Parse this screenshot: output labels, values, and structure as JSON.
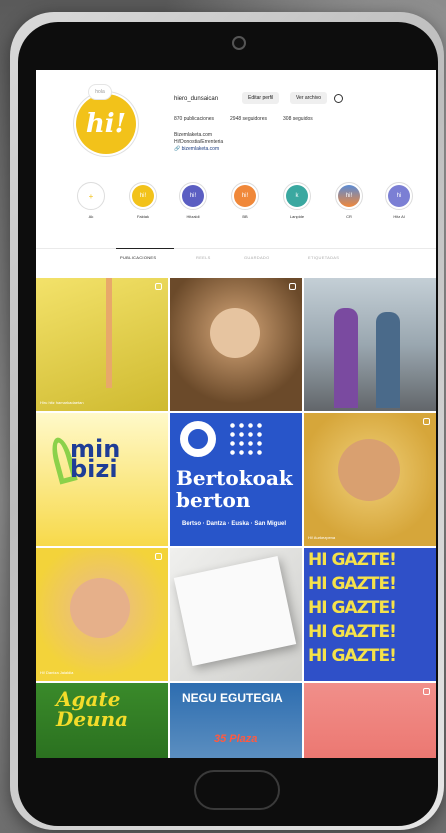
{
  "profile": {
    "avatar_text": "hi!",
    "avatar_bubble": "hola",
    "username": "hiero_dunsaican",
    "edit_label": "Editar perfil",
    "archive_label": "Ver archivo",
    "stats": {
      "posts": "870 publicaciones",
      "followers": "2948 seguidores",
      "following": "308 seguidos"
    },
    "bio_line1": "Bizemlaketa.com",
    "bio_line2": "Hi!Donostia/Errenteria",
    "bio_link": "🔗 bizemlaketa.com"
  },
  "highlights": [
    {
      "label": "Ak",
      "color": "#ffffff"
    },
    {
      "label": "Faktak",
      "color": "#f2c21a"
    },
    {
      "label": "Hitzaldi",
      "color": "#5b5ec2"
    },
    {
      "label": "BB",
      "color": "#f0883a"
    },
    {
      "label": "Lanpide",
      "color": "#3aa8a0"
    },
    {
      "label": "CR",
      "color": "#e45a5a"
    },
    {
      "label": "Hitz Al",
      "color": "#7b7fd4"
    }
  ],
  "tabs": [
    "PUBLICACIONES",
    "REELS",
    "GUARDADO",
    "ETIQUETADAS"
  ],
  "grid": [
    {
      "caption": "Hiru hitz hamarkadaetan"
    },
    {
      "caption": ""
    },
    {
      "caption": ""
    },
    {
      "text1": "min",
      "text2": "bizi"
    },
    {
      "big1": "Bertokoak",
      "big2": "berton",
      "small": "Bertso · Dantza · Euska · San Miguel"
    },
    {
      "caption": "Hi! Aurkezpena"
    },
    {
      "caption": "Hi! Dantza Jaialdia"
    },
    {
      "caption": ""
    },
    {
      "gazte": "HI GAZTE!"
    },
    {
      "title1": "Agate",
      "title2": "Deuna"
    },
    {
      "title": "NEGU EGUTEGIA",
      "badge": "35 Plaza"
    },
    {
      "caption": ""
    }
  ]
}
